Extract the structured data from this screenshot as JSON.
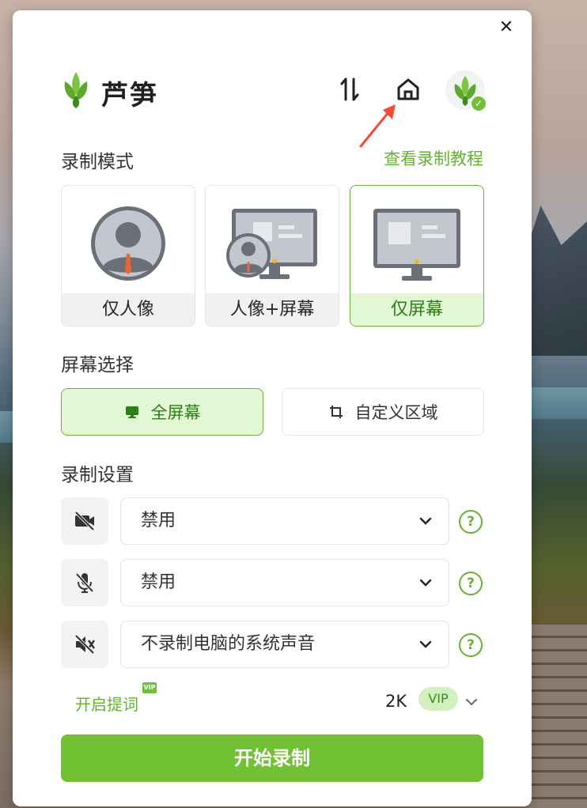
{
  "app": {
    "brand": "芦笋",
    "close_glyph": "✕"
  },
  "header": {
    "swap_icon": "swap-vertical-icon",
    "home_icon": "home-icon",
    "avatar_badge": "✓"
  },
  "record_mode": {
    "title": "录制模式",
    "tutorial_link": "查看录制教程",
    "options": [
      {
        "label": "仅人像",
        "active": false
      },
      {
        "label": "人像+屏幕",
        "active": false
      },
      {
        "label": "仅屏幕",
        "active": true
      }
    ]
  },
  "screen_select": {
    "title": "屏幕选择",
    "options": [
      {
        "label": "全屏幕",
        "icon": "monitor-icon",
        "active": true
      },
      {
        "label": "自定义区域",
        "icon": "crop-icon",
        "active": false
      }
    ]
  },
  "record_settings": {
    "title": "录制设置",
    "rows": [
      {
        "icon": "camera-off-icon",
        "value": "禁用",
        "help": "?"
      },
      {
        "icon": "mic-off-icon",
        "value": "禁用",
        "help": "?"
      },
      {
        "icon": "speaker-off-icon",
        "value": "不录制电脑的系统声音",
        "help": "?"
      }
    ]
  },
  "footer": {
    "prompter_label": "开启提词",
    "prompter_vip": "VIP",
    "resolution": "2K",
    "resolution_badge": "VIP",
    "start_button": "开始录制"
  },
  "colors": {
    "accent": "#72c135",
    "accent_text": "#67b132",
    "active_bg": "#e2f7d4"
  }
}
